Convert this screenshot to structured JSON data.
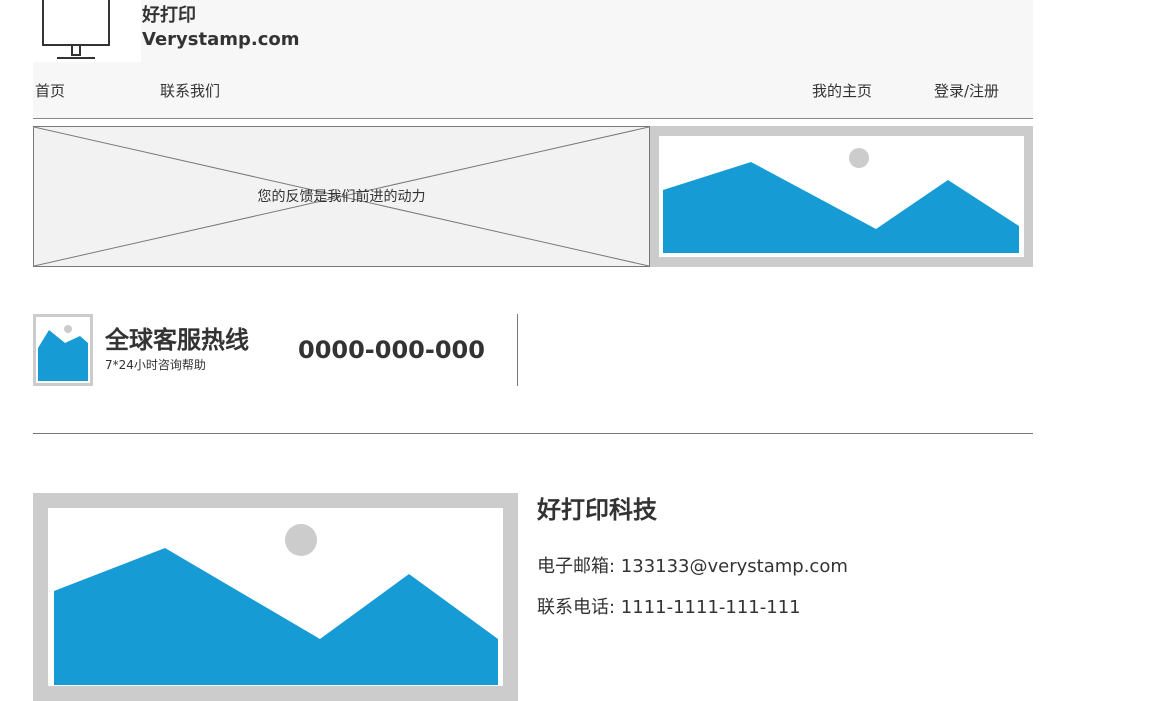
{
  "header": {
    "brand_name": "好打印",
    "brand_site": "Verystamp.com",
    "logo_icon": "monitor-icon",
    "background": "#f7f7f7"
  },
  "nav": {
    "home": "首页",
    "contact_us": "联系我们",
    "my_home": "我的主页",
    "login_register": "登录/注册"
  },
  "banner": {
    "text": "您的反馈是我们前进的动力",
    "image_icon": "image-placeholder-icon"
  },
  "hotline": {
    "title": "全球客服热线",
    "subtitle": "7*24小时咨询帮助",
    "phone": "0000-000-000",
    "image_icon": "image-placeholder-icon"
  },
  "company": {
    "name": "好打印科技",
    "email": "电子邮箱: 133133@verystamp.com",
    "phone": "联系电话: 1111-1111-111-111",
    "image_icon": "image-placeholder-icon"
  },
  "colors": {
    "placeholder_frame": "#cccccc",
    "placeholder_mountain": "#169bd5",
    "text": "#333333",
    "divider": "#797979"
  }
}
